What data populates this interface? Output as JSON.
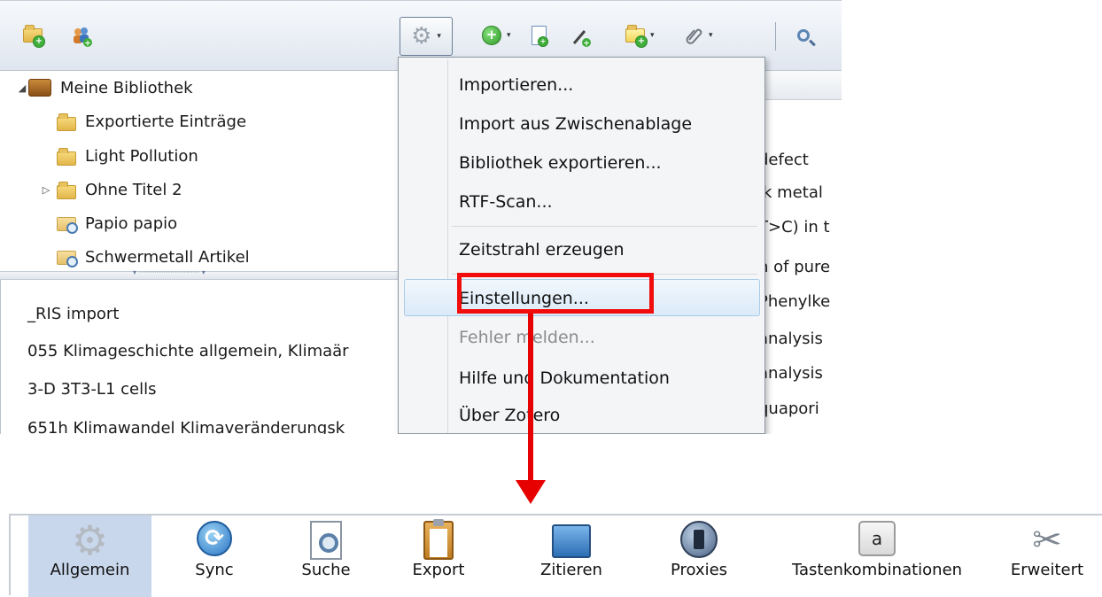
{
  "toolbar": {
    "new_collection_icon": "folder-plus-icon",
    "new_group_icon": "group-plus-icon",
    "actions_icon": "gear-icon",
    "new_item_icon": "green-plus-icon",
    "new_note_icon": "note-icon",
    "attachment_icon": "paperclip-icon",
    "search_icon": "magnifier-icon"
  },
  "library": {
    "root": "Meine Bibliothek",
    "collections": [
      {
        "label": "Exportierte Einträge",
        "icon": "folder-icon"
      },
      {
        "label": "Light Pollution",
        "icon": "folder-icon"
      },
      {
        "label": "Ohne Titel 2",
        "icon": "folder-icon",
        "expandable": true
      },
      {
        "label": "Papio papio",
        "icon": "saved-search-icon"
      },
      {
        "label": "Schwermetall Artikel",
        "icon": "saved-search-icon"
      }
    ]
  },
  "tags": [
    "_RIS import",
    "055 Klimageschichte allgemein, Klimaär",
    "3-D   3T3-L1 cells",
    "651h Klimawandel  Klimaveränderungsk"
  ],
  "items_fragments": [
    "defect",
    "lk metal",
    "T>C) in t",
    "n of pure",
    "Phenylke",
    "analysis",
    "analysis",
    "quapori"
  ],
  "menu": {
    "items": [
      {
        "label": "Importieren...",
        "enabled": true
      },
      {
        "label": "Import aus Zwischenablage",
        "enabled": true
      },
      {
        "label": "Bibliothek exportieren...",
        "enabled": true
      },
      {
        "label": "RTF-Scan...",
        "enabled": true
      },
      {
        "label": "Zeitstrahl erzeugen",
        "enabled": true
      },
      {
        "label": "Einstellungen...",
        "enabled": true,
        "highlighted": true
      },
      {
        "label": "Fehler melden...",
        "enabled": false
      },
      {
        "label": "Hilfe und Dokumentation",
        "enabled": true
      },
      {
        "label": "Über Zotero",
        "enabled": true
      }
    ]
  },
  "annotation": {
    "color": "#f20d0d"
  },
  "preferences": {
    "selected": "Allgemein",
    "panes": [
      {
        "label": "Allgemein",
        "icon": "gear-icon"
      },
      {
        "label": "Sync",
        "icon": "sync-icon"
      },
      {
        "label": "Suche",
        "icon": "search-document-icon"
      },
      {
        "label": "Export",
        "icon": "clipboard-icon"
      },
      {
        "label": "Zitieren",
        "icon": "folder-open-icon"
      },
      {
        "label": "Proxies",
        "icon": "proxy-door-icon"
      },
      {
        "label": "Tastenkombinationen",
        "icon": "keyboard-key-icon",
        "key": "a"
      },
      {
        "label": "Erweitert",
        "icon": "tools-icon"
      }
    ]
  }
}
